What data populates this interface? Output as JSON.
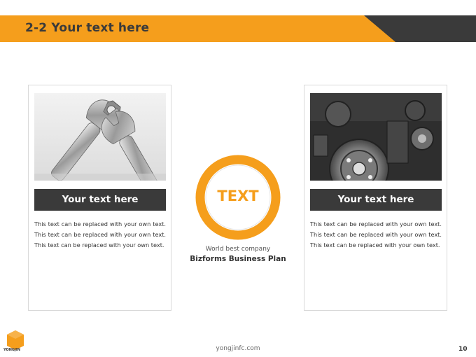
{
  "header": {
    "title": "2-2 Your text here"
  },
  "colors": {
    "accent": "#f59e1c",
    "dark": "#3a3a3a"
  },
  "left_card": {
    "image": "wrench-photo",
    "title": "Your text here",
    "body": "This text can be replaced with your own text. This text can be replaced with your own text. This text can be replaced with your own text."
  },
  "right_card": {
    "image": "engine-photo",
    "title": "Your text here",
    "body": "This text can be replaced with your own text. This text can be replaced with your own text. This text can be replaced with your own text."
  },
  "center": {
    "ring_label": "TEXT",
    "caption": "World best company",
    "plan": "Bizforms Business Plan"
  },
  "footer": {
    "logo_text": "YONGJIN",
    "url": "yongjinfc.com",
    "page_number": "10"
  }
}
